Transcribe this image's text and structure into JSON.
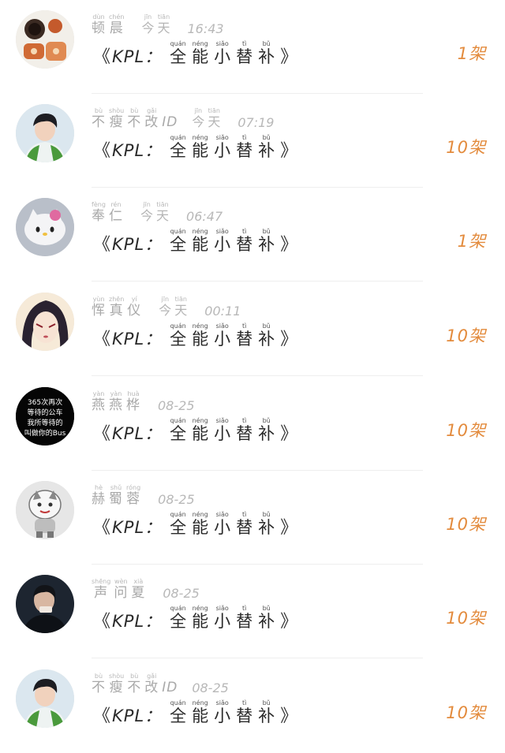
{
  "message": {
    "open": "《",
    "prefix": "KPL：",
    "chars": [
      {
        "hanzi": "全",
        "pinyin": "quán"
      },
      {
        "hanzi": "能",
        "pinyin": "néng"
      },
      {
        "hanzi": "小",
        "pinyin": "siǎo"
      },
      {
        "hanzi": "替",
        "pinyin": "tì"
      },
      {
        "hanzi": "补",
        "pinyin": "bǔ"
      }
    ],
    "close": "》"
  },
  "rows": [
    {
      "name": "顿晨",
      "name_pinyin": [
        "dùn",
        "chén"
      ],
      "today": "今天",
      "today_pinyin": [
        "jīn",
        "tiān"
      ],
      "time": "16:43",
      "count": "1架"
    },
    {
      "name": "不瘦不改ID",
      "name_pinyin": [
        "bù",
        "shòu",
        "bù",
        "gǎi",
        "",
        ""
      ],
      "today": "今天",
      "today_pinyin": [
        "jīn",
        "tiān"
      ],
      "time": "07:19",
      "count": "10架"
    },
    {
      "name": "奉仁",
      "name_pinyin": [
        "fèng",
        "rén"
      ],
      "today": "今天",
      "today_pinyin": [
        "jīn",
        "tiān"
      ],
      "time": "06:47",
      "count": "1架"
    },
    {
      "name": "恽真仪",
      "name_pinyin": [
        "yùn",
        "zhēn",
        "yí"
      ],
      "today": "今天",
      "today_pinyin": [
        "jīn",
        "tiān"
      ],
      "time": "00:11",
      "count": "10架"
    },
    {
      "name": "燕燕桦",
      "name_pinyin": [
        "yàn",
        "yàn",
        "huà"
      ],
      "today": "",
      "today_pinyin": [],
      "time": "08-25",
      "count": "10架"
    },
    {
      "name": "赫蜀蓉",
      "name_pinyin": [
        "hè",
        "shǔ",
        "róng"
      ],
      "today": "",
      "today_pinyin": [],
      "time": "08-25",
      "count": "10架"
    },
    {
      "name": "声问夏",
      "name_pinyin": [
        "shēng",
        "wèn",
        "xià"
      ],
      "today": "",
      "today_pinyin": [],
      "time": "08-25",
      "count": "10架"
    },
    {
      "name": "不瘦不改ID",
      "name_pinyin": [
        "bù",
        "shòu",
        "bù",
        "gǎi",
        "",
        ""
      ],
      "today": "",
      "today_pinyin": [],
      "time": "08-25",
      "count": "10架"
    }
  ],
  "avatar_text": [
    "365次再次",
    "等待的公车",
    "我所等待的",
    "叫做你的Bus"
  ],
  "colors": {
    "accent": "#e38b3d",
    "meta": "#b5b5b5",
    "text": "#2a2a2a",
    "divider": "#eeeeee"
  },
  "icons": {
    "avatars": [
      "food-avatar",
      "person-avatar",
      "hello-kitty-avatar",
      "anime-avatar",
      "text-avatar",
      "cartoon-avatar",
      "dark-person-avatar",
      "person-avatar"
    ]
  }
}
